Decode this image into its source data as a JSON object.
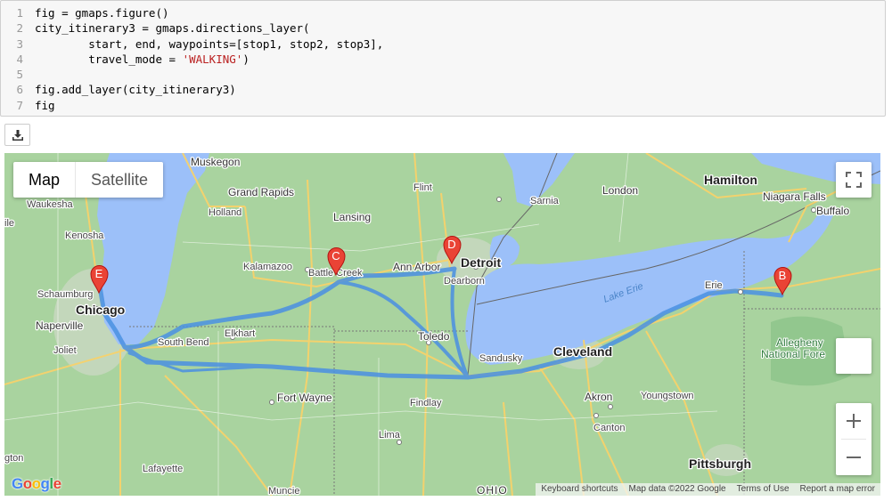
{
  "code": {
    "lines": [
      {
        "num": "1",
        "text": "fig = gmaps.figure()"
      },
      {
        "num": "2",
        "text": "city_itinerary3 = gmaps.directions_layer("
      },
      {
        "num": "3",
        "text": "        start, end, waypoints=[stop1, stop2, stop3],"
      },
      {
        "num": "4",
        "pre": "        travel_mode = ",
        "str": "'WALKING'",
        "post": ")"
      },
      {
        "num": "5",
        "text": ""
      },
      {
        "num": "6",
        "text": "fig.add_layer(city_itinerary3)"
      },
      {
        "num": "7",
        "text": "fig"
      }
    ]
  },
  "toolbar": {
    "download_icon": "download-icon"
  },
  "map": {
    "map_type": {
      "map_label": "Map",
      "satellite_label": "Satellite",
      "selected": "Map"
    },
    "markers": {
      "B": "B",
      "C": "C",
      "D": "D",
      "E": "E"
    },
    "labels": {
      "chicago": "Chicago",
      "detroit": "Detroit",
      "cleveland": "Cleveland",
      "pittsburgh": "Pittsburgh",
      "hamilton": "Hamilton",
      "muskegon": "Muskegon",
      "grand_rapids": "Grand Rapids",
      "holland": "Holland",
      "lansing": "Lansing",
      "flint": "Flint",
      "waukesha": "Waukesha",
      "kenosha": "Kenosha",
      "kalamazoo": "Kalamazoo",
      "battle_creek": "Battle Creek",
      "ann_arbor": "Ann Arbor",
      "dearborn": "Dearborn",
      "sarnia": "Sarnia",
      "london": "London",
      "niagara_falls": "Niagara Falls",
      "buffalo": "Buffalo",
      "schaumburg": "Schaumburg",
      "naperville": "Naperville",
      "joliet": "Joliet",
      "south_bend": "South Bend",
      "elkhart": "Elkhart",
      "toledo": "Toledo",
      "sandusky": "Sandusky",
      "erie": "Erie",
      "lake_erie": "Lake Erie",
      "fort_wayne": "Fort Wayne",
      "findlay": "Findlay",
      "akron": "Akron",
      "youngstown": "Youngstown",
      "canton": "Canton",
      "lima": "Lima",
      "lafayette": "Lafayette",
      "muncie": "Muncie",
      "ohio": "OHIO",
      "allegheny": "Allegheny",
      "national_forest": "National Fore",
      "gton": "gton",
      "ile": "ile"
    },
    "attribution": {
      "shortcuts": "Keyboard shortcuts",
      "map_data": "Map data ©2022 Google",
      "terms": "Terms of Use",
      "report": "Report a map error"
    },
    "logo": "Google",
    "colors": {
      "route": "#4a90e2",
      "marker": "#ea4335",
      "water": "#9cc0f9",
      "land": "#a9d39f"
    }
  }
}
